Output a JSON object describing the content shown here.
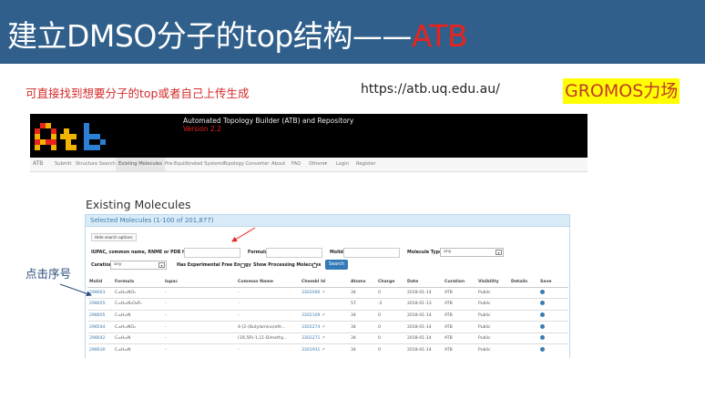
{
  "slide": {
    "title_main": "建立DMSO分子的top结构——",
    "title_highlight": "ATB",
    "note_left": "可直接找到想要分子的top或者自己上传生成",
    "url": "https://atb.uq.edu.au/",
    "forcefield_badge": "GROMOS力场",
    "click_note": "点击序号",
    "colors": {
      "title_bar": "#2f5f8a",
      "highlight": "#e8231e",
      "badge_bg": "#ffff00",
      "link": "#3a7bb0"
    }
  },
  "site": {
    "logo_text": "ATb",
    "title": "Automated Topology Builder (ATB) and Repository",
    "version": "Version 2.2",
    "nav": {
      "brand": "ATB",
      "items": [
        "Submit",
        "Structure Search",
        "Existing Molecules",
        "Pre-Equilibrated Systems",
        "Topology Converter",
        "About",
        "FAQ",
        "Others▾",
        "Login",
        "Register"
      ],
      "active": "Existing Molecules"
    },
    "page_title": "Existing Molecules",
    "panel_title": "Selected Molecules (1-100 of 201,877)",
    "hide_button": "Hide search options",
    "filters": {
      "iupac_label": "IUPAC, common name, RNME or PDB hetId",
      "formula_label": "Formula",
      "molid_label": "Molid",
      "moltype_label": "Molecule Type",
      "moltype_value": "any",
      "curation_label": "Curation",
      "curation_value": "any",
      "free_energy_label": "Has Experimental Free Energy",
      "processing_label": "Show Processing Molecules",
      "search_button": "Search"
    },
    "table": {
      "columns": [
        "Molid",
        "Formula",
        "Iupac",
        "Common Name",
        "Chembl Id",
        "Atoms",
        "Charge",
        "Date",
        "Curation",
        "Visibility",
        "Details",
        "Save"
      ],
      "rows": [
        [
          "298663",
          "C₁₆H₂₁NO₂",
          "-",
          "-",
          "3302000",
          "34",
          "0",
          "2018-01-14",
          "ATB",
          "Public",
          "",
          ""
        ],
        [
          "298655",
          "C₁₅H₂₂N₂O₈P₂",
          "-",
          "-",
          "",
          "57",
          "-2",
          "2018-01-13",
          "ATB",
          "Public",
          "",
          ""
        ],
        [
          "298605",
          "C₁₆H₁₅N",
          "-",
          "-",
          "3302109",
          "34",
          "0",
          "2018-01-14",
          "ATB",
          "Public",
          "",
          ""
        ],
        [
          "298544",
          "C₁₆H₂₁NO₂",
          "-",
          "4-[2-(Butylamino)eth...",
          "3302274",
          "34",
          "0",
          "2018-01-14",
          "ATB",
          "Public",
          "",
          ""
        ],
        [
          "298642",
          "C₁₆H₂₂N",
          "-",
          "(1R,5R)-1,11-Dimethy...",
          "3302271",
          "34",
          "0",
          "2018-01-14",
          "ATB",
          "Public",
          "",
          ""
        ],
        [
          "298630",
          "C₁₆H₂₂N",
          "-",
          "-",
          "3301931",
          "34",
          "0",
          "2018-01-14",
          "ATB",
          "Public",
          "",
          ""
        ]
      ]
    }
  }
}
